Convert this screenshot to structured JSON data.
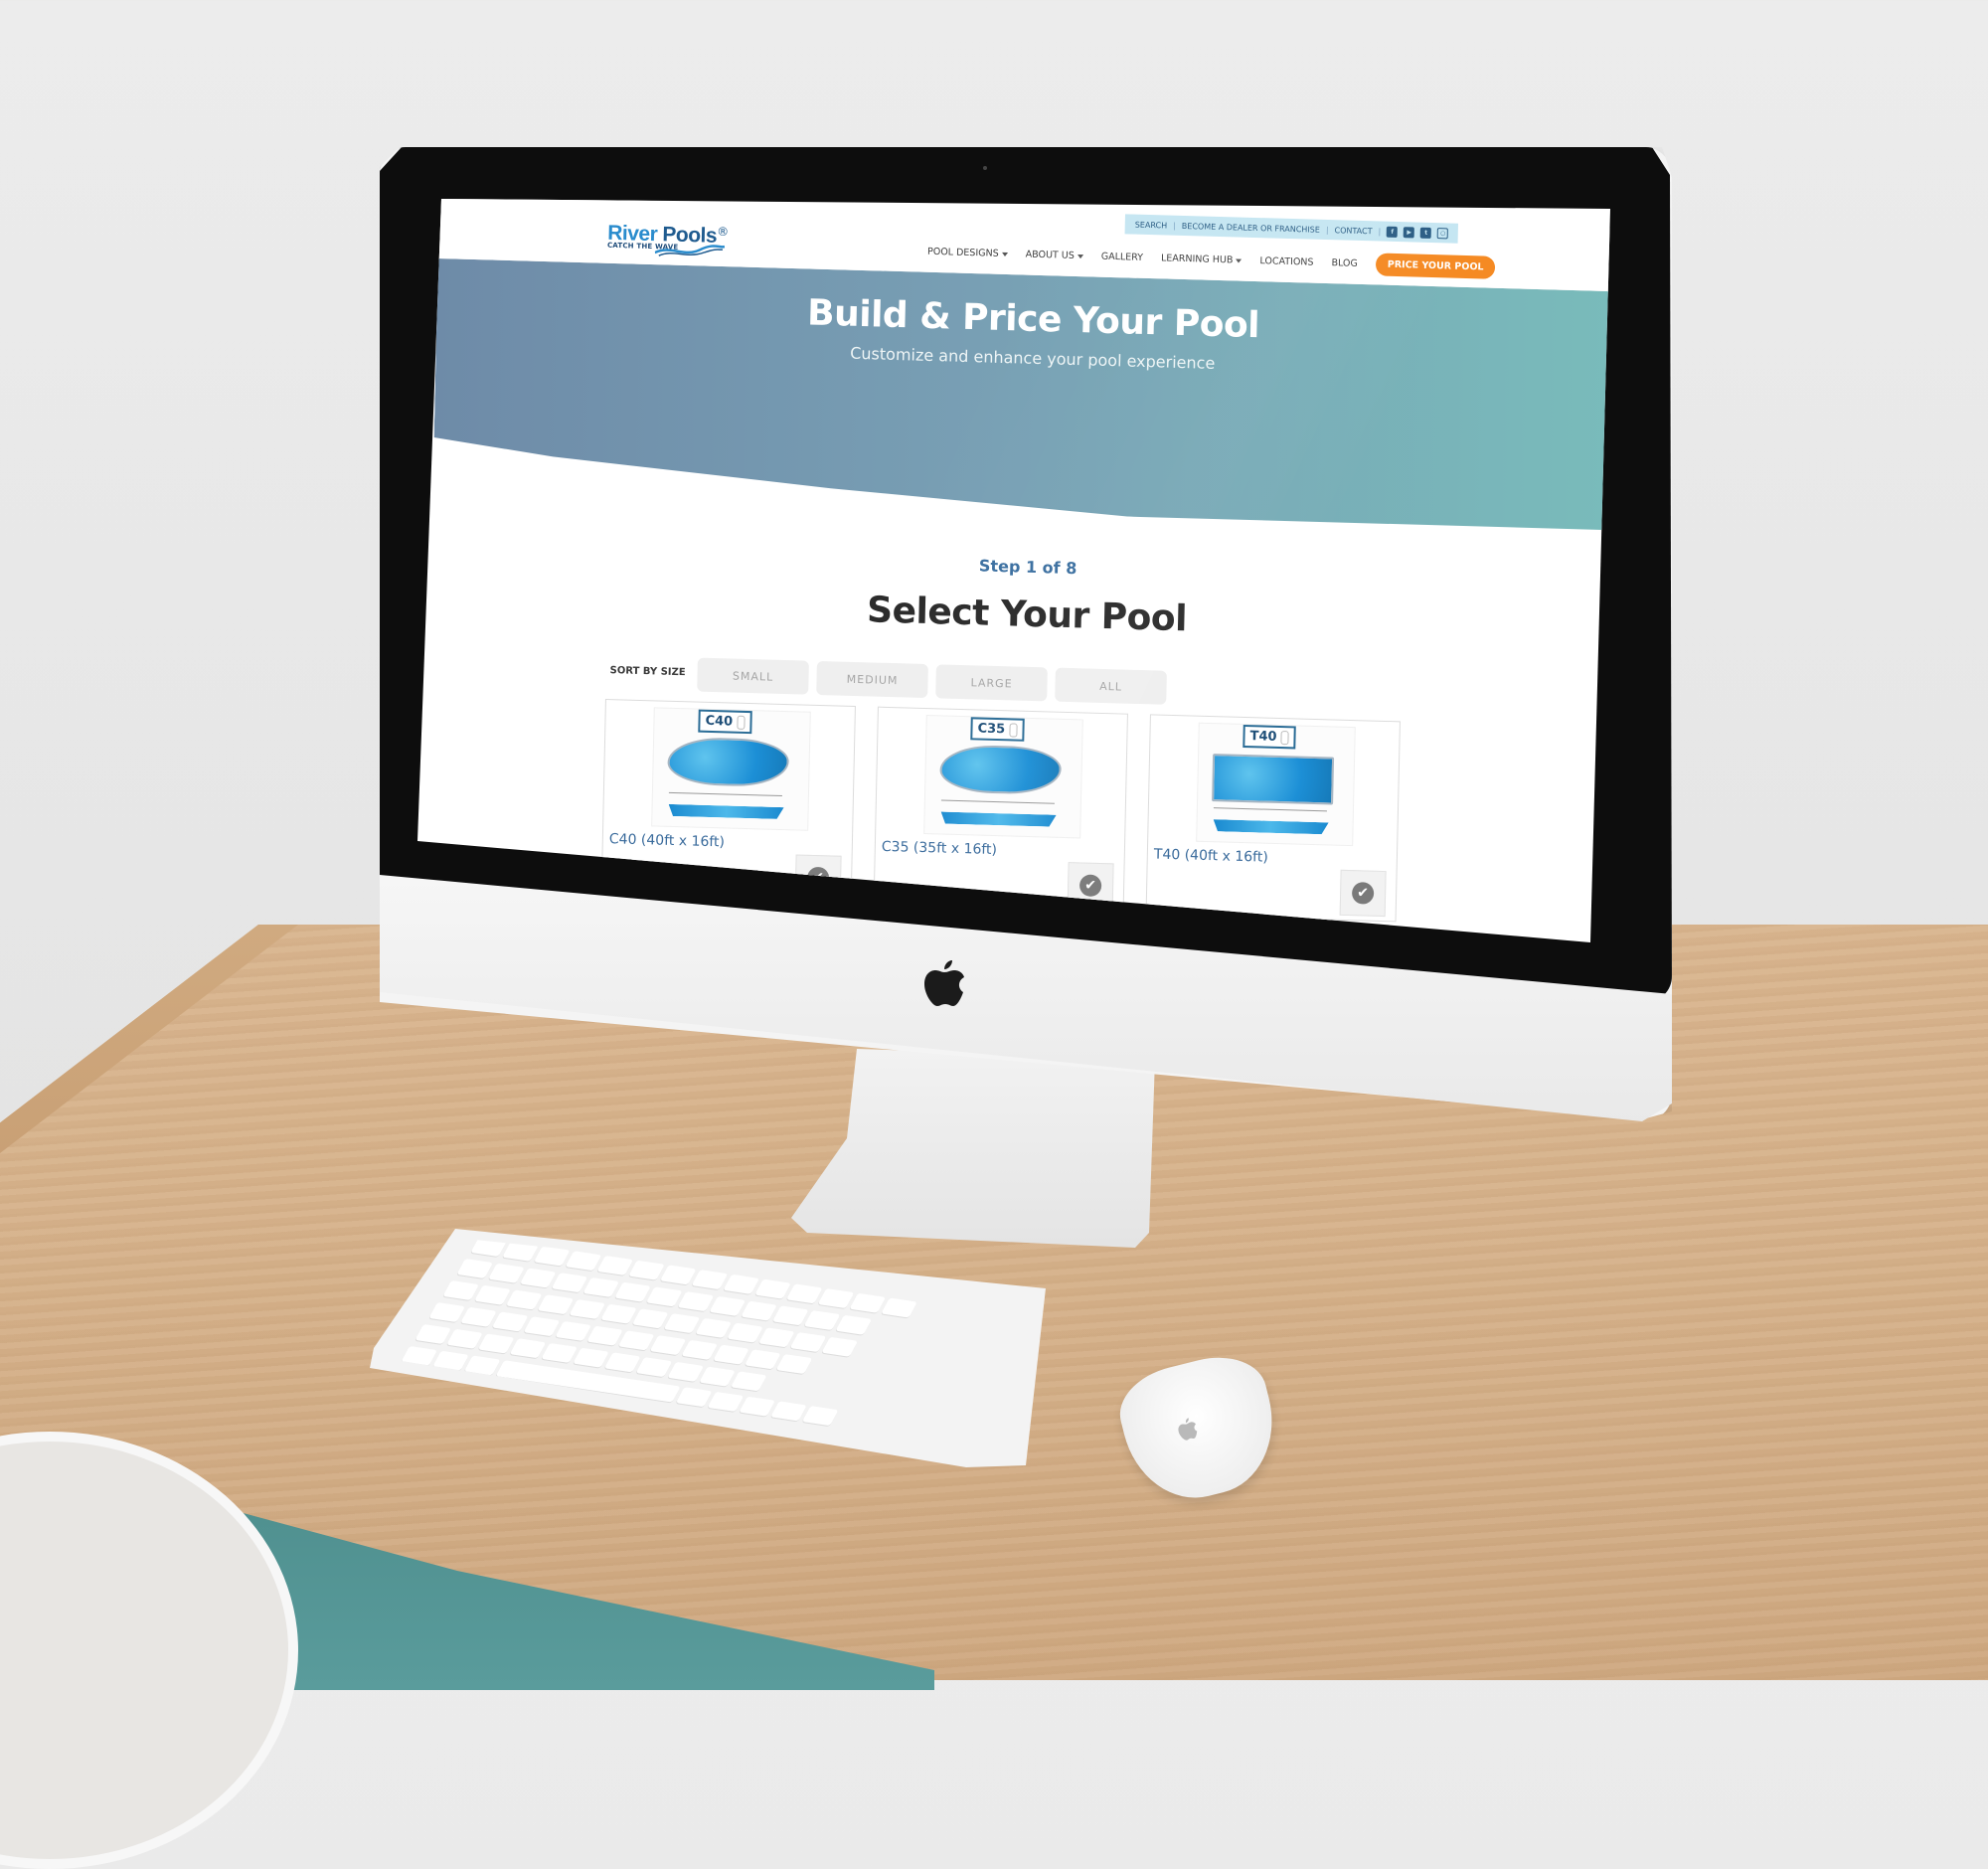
{
  "scene": {
    "device": "iMac",
    "accessories": [
      "keyboard",
      "mouse"
    ]
  },
  "site": {
    "logo": {
      "word1": "River",
      "word2": "Pools",
      "registered": "®",
      "tagline": "CATCH THE WAVE"
    },
    "utility_bar": {
      "links": [
        "SEARCH",
        "BECOME A DEALER OR FRANCHISE",
        "CONTACT"
      ],
      "separator": "|",
      "social_icons": [
        "facebook-icon",
        "youtube-icon",
        "twitter-icon",
        "instagram-icon"
      ]
    },
    "nav": {
      "items": [
        {
          "label": "POOL DESIGNS",
          "dropdown": true
        },
        {
          "label": "ABOUT US",
          "dropdown": true
        },
        {
          "label": "GALLERY",
          "dropdown": false
        },
        {
          "label": "LEARNING HUB",
          "dropdown": true
        },
        {
          "label": "LOCATIONS",
          "dropdown": false
        },
        {
          "label": "BLOG",
          "dropdown": false
        }
      ],
      "cta_label": "PRICE YOUR POOL"
    },
    "hero": {
      "title": "Build & Price Your Pool",
      "subtitle": "Customize and enhance your pool experience"
    },
    "step": {
      "label": "Step 1 of 8",
      "current": 1,
      "total": 8,
      "title": "Select Your Pool"
    },
    "sort": {
      "label": "SORT BY SIZE",
      "options": [
        "SMALL",
        "MEDIUM",
        "LARGE",
        "ALL"
      ]
    },
    "pools": [
      {
        "code": "C40",
        "name": "C40 (40ft x 16ft)",
        "shape": "curvy"
      },
      {
        "code": "C35",
        "name": "C35 (35ft x 16ft)",
        "shape": "curvy"
      },
      {
        "code": "T40",
        "name": "T40 (40ft x 16ft)",
        "shape": "rect"
      }
    ],
    "colors": {
      "brand_blue": "#2a8ccd",
      "brand_navy": "#1f5b8f",
      "cta_orange": "#f58a23",
      "hero_start": "#6e8ba8",
      "hero_end": "#79bcbb",
      "utility_bar_bg": "#c5e6f2",
      "step_blue": "#3b6fa0"
    },
    "check_symbol": "✔"
  }
}
